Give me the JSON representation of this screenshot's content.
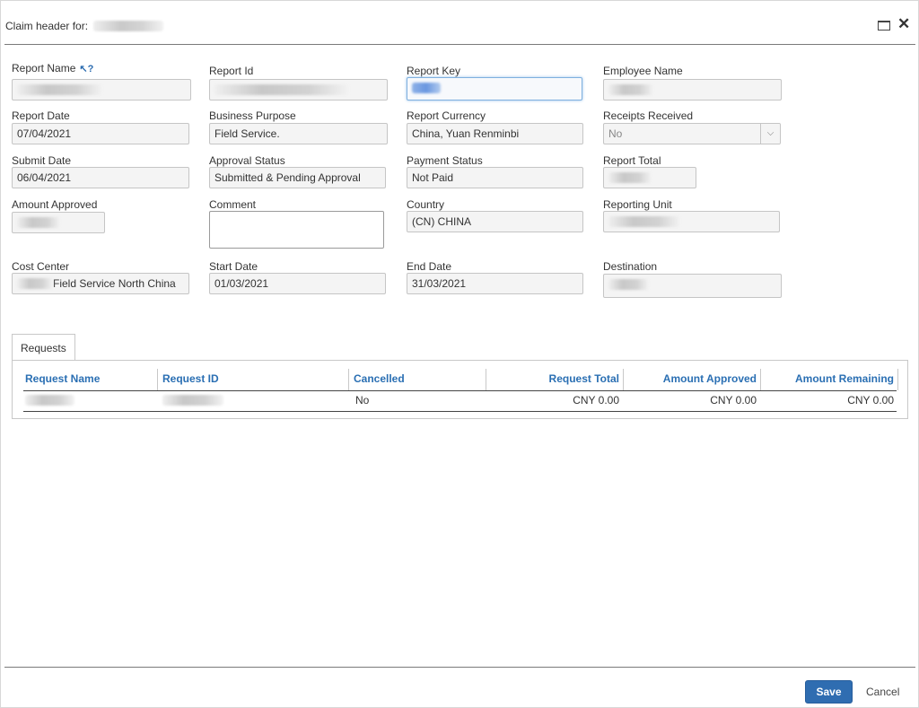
{
  "title": "Claim header for:",
  "fields": {
    "report_name": {
      "label": "Report Name",
      "help": "?"
    },
    "report_id": {
      "label": "Report Id"
    },
    "report_key": {
      "label": "Report Key"
    },
    "employee_name": {
      "label": "Employee Name"
    },
    "report_date": {
      "label": "Report Date",
      "value": "07/04/2021"
    },
    "business_purpose": {
      "label": "Business Purpose",
      "value": "Field Service."
    },
    "report_currency": {
      "label": "Report Currency",
      "value": "China, Yuan Renminbi"
    },
    "receipts_received": {
      "label": "Receipts Received",
      "value": "No"
    },
    "submit_date": {
      "label": "Submit Date",
      "value": "06/04/2021"
    },
    "approval_status": {
      "label": "Approval Status",
      "value": "Submitted & Pending Approval"
    },
    "payment_status": {
      "label": "Payment Status",
      "value": "Not Paid"
    },
    "report_total": {
      "label": "Report Total"
    },
    "amount_approved": {
      "label": "Amount Approved"
    },
    "comment": {
      "label": "Comment",
      "value": ""
    },
    "country": {
      "label": "Country",
      "value": "(CN) CHINA"
    },
    "reporting_unit": {
      "label": "Reporting Unit"
    },
    "cost_center": {
      "label": "Cost Center",
      "value": "Field Service North China"
    },
    "start_date": {
      "label": "Start Date",
      "value": "01/03/2021"
    },
    "end_date": {
      "label": "End Date",
      "value": "31/03/2021"
    },
    "destination": {
      "label": "Destination"
    }
  },
  "tabs": [
    {
      "label": "Requests"
    }
  ],
  "requests_table": {
    "columns": [
      "Request Name",
      "Request ID",
      "Cancelled",
      "Request Total",
      "Amount Approved",
      "Amount Remaining"
    ],
    "rows": [
      {
        "cancelled": "No",
        "request_total": "CNY 0.00",
        "amount_approved": "CNY 0.00",
        "amount_remaining": "CNY 0.00"
      }
    ]
  },
  "footer": {
    "save_label": "Save",
    "cancel_label": "Cancel"
  },
  "colors": {
    "accent": "#2f6db1",
    "header_text": "#2a6fb3"
  }
}
